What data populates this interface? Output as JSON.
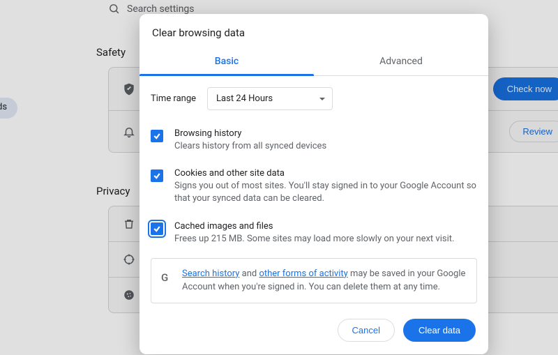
{
  "search_placeholder": "Search settings",
  "sections": {
    "safety": "Safety",
    "privacy": "Privacy"
  },
  "safety_buttons": {
    "check": "Check now",
    "review": "Review"
  },
  "modal": {
    "title": "Clear browsing data",
    "tabs": {
      "basic": "Basic",
      "advanced": "Advanced"
    },
    "time_range_label": "Time range",
    "time_range_value": "Last 24 Hours",
    "options": [
      {
        "title": "Browsing history",
        "desc": "Clears history from all synced devices"
      },
      {
        "title": "Cookies and other site data",
        "desc": "Signs you out of most sites. You'll stay signed in to your Google Account so that your synced data can be cleared."
      },
      {
        "title": "Cached images and files",
        "desc": "Frees up 215 MB. Some sites may load more slowly on your next visit."
      }
    ],
    "note": {
      "link1": "Search history",
      "mid1": " and ",
      "link2": "other forms of activity",
      "rest": " may be saved in your Google Account when you're signed in. You can delete them at any time."
    },
    "actions": {
      "cancel": "Cancel",
      "clear": "Clear data"
    }
  }
}
